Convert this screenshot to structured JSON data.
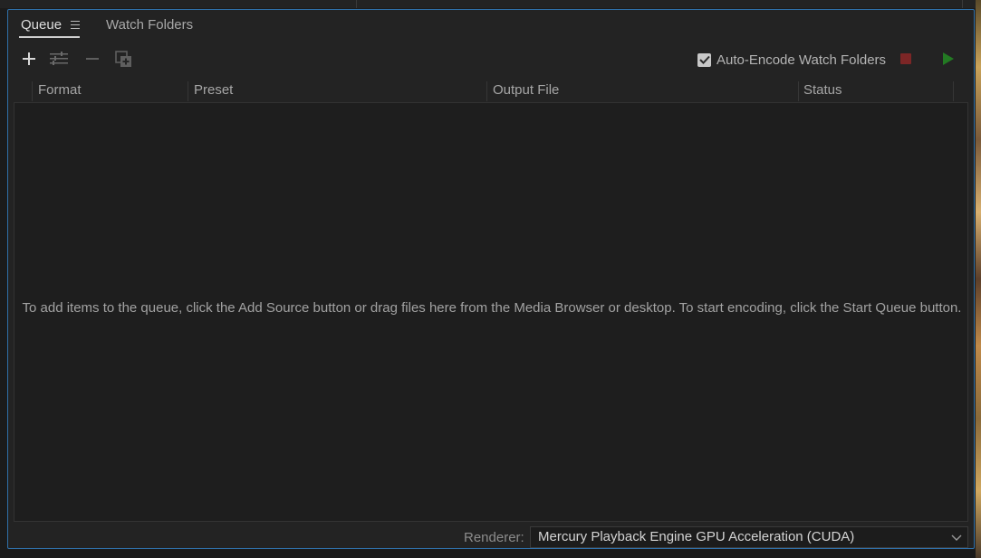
{
  "tabs": {
    "queue_label": "Queue",
    "watch_label": "Watch Folders"
  },
  "toolbar": {
    "add_icon": "plus-icon",
    "settings_icon": "sliders-icon",
    "remove_icon": "minus-icon",
    "duplicate_icon": "duplicate-icon",
    "auto_encode_label": "Auto-Encode Watch Folders",
    "auto_encode_checked": true,
    "stop_color": "#8a2a2a",
    "start_color": "#2a7a2a"
  },
  "table": {
    "columns": [
      "Format",
      "Preset",
      "Output File",
      "Status"
    ]
  },
  "empty_message": "To add items to the queue, click the Add Source button or drag files here from the Media Browser or desktop.  To start encoding, click the Start Queue button.",
  "renderer": {
    "label": "Renderer:",
    "value": "Mercury Playback Engine GPU Acceleration (CUDA)"
  },
  "colors": {
    "accent": "#2f6fa8",
    "background": "#232323"
  }
}
